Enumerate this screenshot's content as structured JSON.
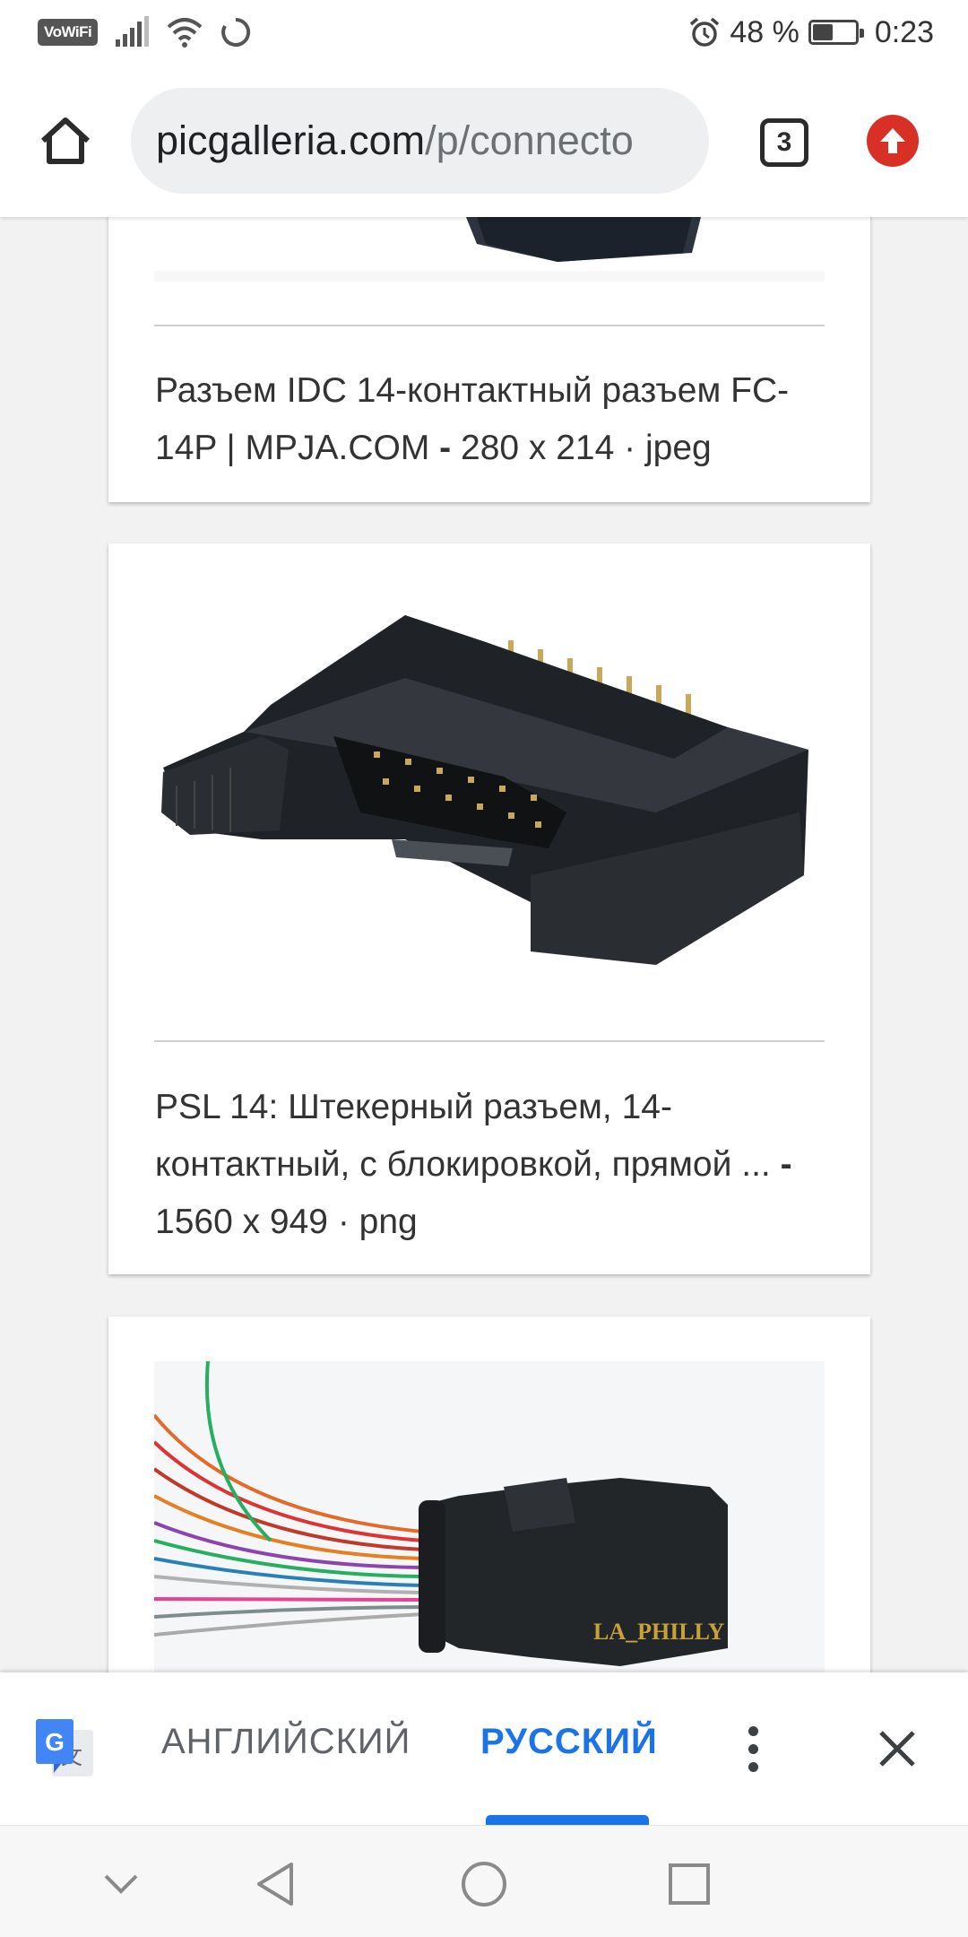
{
  "status_bar": {
    "vowifi": "VoWiFi",
    "battery_text": "48 %",
    "battery_level": 0.48,
    "time": "0:23"
  },
  "toolbar": {
    "url_domain": "picgalleria.com",
    "url_path": "/p/connecto",
    "tab_count": "3"
  },
  "results": [
    {
      "title": "Разъем IDC 14-контактный разъем FC-14P | MPJA.COM",
      "separator": " - ",
      "meta": "280 x 214 · jpeg"
    },
    {
      "title": "PSL 14: Штекерный разъем, 14-контактный, с блокировкой, прямой ...",
      "separator": " - ",
      "meta": "1560 x 949 · png"
    },
    {
      "watermark": "LA_PHILLY"
    }
  ],
  "translate_bar": {
    "source_lang": "АНГЛИЙСКИЙ",
    "target_lang": "РУССКИЙ",
    "selected": "target"
  },
  "colors": {
    "accent": "#1a73e8",
    "update_red": "#d93025"
  },
  "icons": {
    "home": "home-icon",
    "tabs": "tab-switcher-icon",
    "update": "update-available-icon",
    "translate": "google-translate-icon",
    "more": "more-vert-icon",
    "close": "close-icon",
    "nav_down": "chevron-down-icon",
    "nav_back": "back-triangle-icon",
    "nav_home": "home-circle-icon",
    "nav_recents": "recents-square-icon"
  }
}
